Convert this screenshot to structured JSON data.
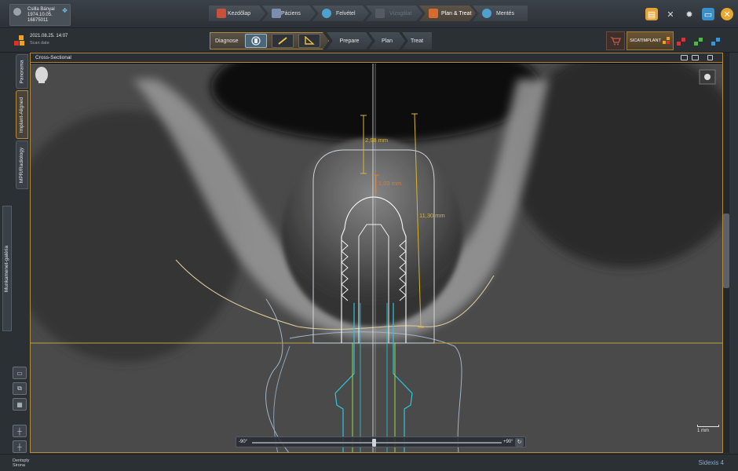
{
  "patient": {
    "name": "Csilla Bányai",
    "birthdate": "1974.10.05.",
    "id": "16875011"
  },
  "workflow": {
    "home": "Kezdőlap",
    "patient": "Páciens",
    "acquire": "Felvétel",
    "examine": "Vizsgálat",
    "plan_treat": "Plan & Treat",
    "save": "Mentés"
  },
  "scan": {
    "date": "2021.08.25. 14:07",
    "label": "Scan date"
  },
  "phases": {
    "diagnose": "Diagnose",
    "prepare": "Prepare",
    "plan": "Plan",
    "treat": "Treat"
  },
  "sicat": "SICATIMPLANT",
  "left_tabs": {
    "panorama": "Panorama",
    "implant_aligned": "Implant-Aligned",
    "mpr": "MPR/Radiology",
    "gallery": "Munkamenet-galéria"
  },
  "view": {
    "title": "Cross-Sectional",
    "measurements": {
      "m1": "2,98 mm",
      "m2": "1,03 mm",
      "m3": "11,30 mm"
    },
    "rotation_min": "-90°",
    "rotation_max": "+90°",
    "scale": "1 mm"
  },
  "status": {
    "brand_top": "Dentsply",
    "brand_bottom": "Sirona",
    "product": "Sidexis 4"
  },
  "colors": {
    "accent": "#b58a3a",
    "measure_yellow": "#d8b532",
    "measure_orange": "#e07a2a",
    "implant_cyan": "#2ec6d6",
    "abutment_green": "#9bd94a"
  }
}
